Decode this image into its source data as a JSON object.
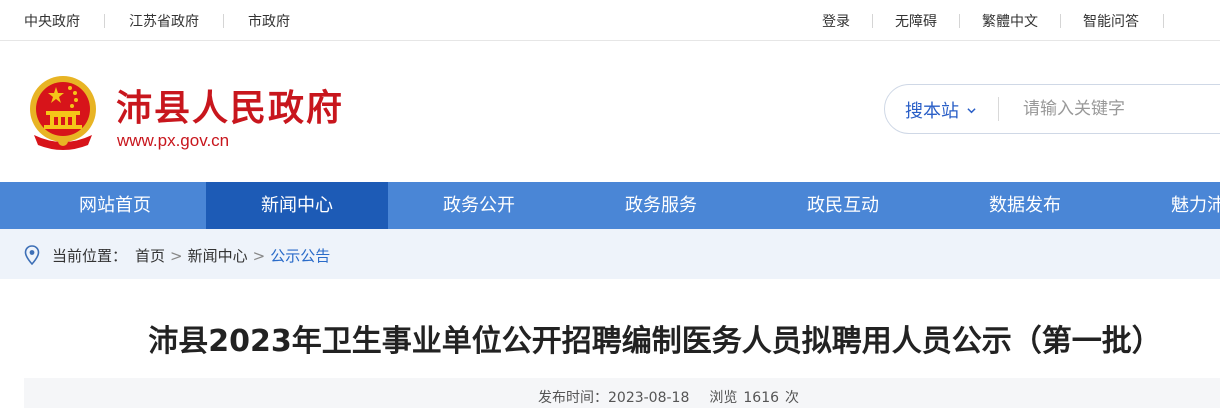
{
  "topbar": {
    "left_links": [
      "中央政府",
      "江苏省政府",
      "市政府"
    ],
    "right_links": [
      "登录",
      "无障碍",
      "繁體中文",
      "智能问答"
    ]
  },
  "header": {
    "site_title": "沛县人民政府",
    "site_url": "www.px.gov.cn",
    "search": {
      "scope_label": "搜本站",
      "placeholder": "请输入关键字"
    }
  },
  "nav": {
    "items": [
      "网站首页",
      "新闻中心",
      "政务公开",
      "政务服务",
      "政民互动",
      "数据发布",
      "魅力沛县"
    ],
    "active_index": 1
  },
  "breadcrumb": {
    "prefix": "当前位置：",
    "items": [
      "首页",
      "新闻中心",
      "公示公告"
    ],
    "separator": ">"
  },
  "article": {
    "title": "沛县2023年卫生事业单位公开招聘编制医务人员拟聘用人员公示（第一批）",
    "publish_label": "发布时间：",
    "publish_date": "2023-08-18",
    "views_label": "浏览",
    "views_count": "1616",
    "views_unit": "次"
  },
  "colors": {
    "brand_red": "#c8161d",
    "nav_blue": "#4a86d6",
    "nav_active": "#1d5bb6",
    "link_blue": "#2a6bc9"
  },
  "icons": {
    "emblem": "national-emblem-icon",
    "location": "location-pin-icon",
    "chevron": "chevron-down-icon"
  }
}
